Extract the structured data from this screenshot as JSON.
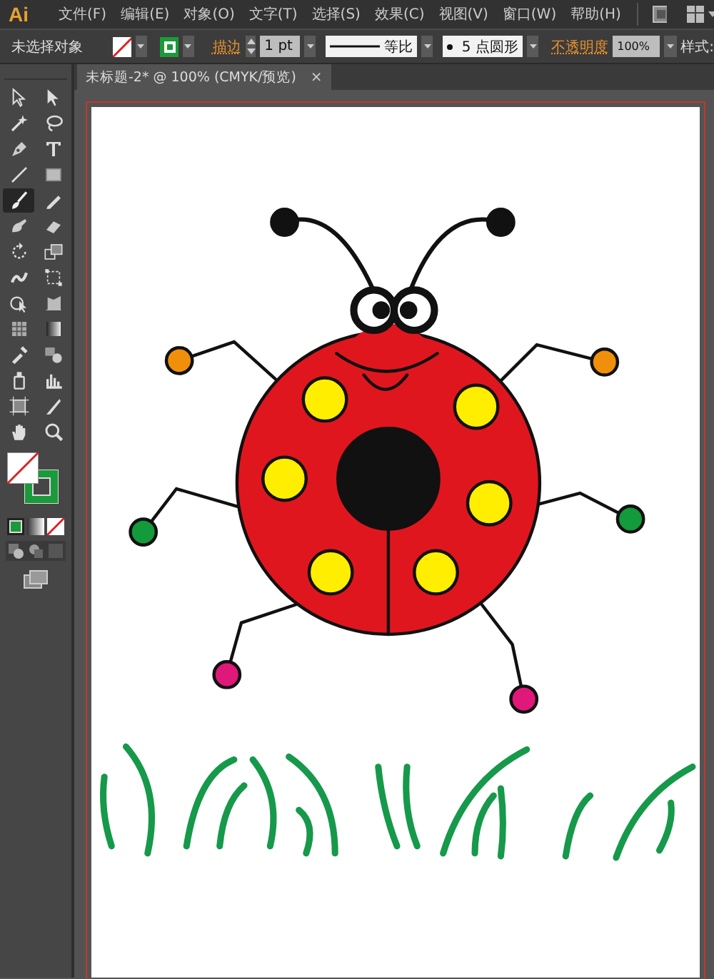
{
  "app": {
    "logo": "Ai"
  },
  "menu": [
    "文件(F)",
    "编辑(E)",
    "对象(O)",
    "文字(T)",
    "选择(S)",
    "效果(C)",
    "视图(V)",
    "窗口(W)",
    "帮助(H)"
  ],
  "control_bar": {
    "selection": "未选择对象",
    "stroke_label": "描边",
    "stroke_weight": "1 pt",
    "profile": "等比",
    "brush": "5 点圆形",
    "opacity_label": "不透明度",
    "opacity": "100%",
    "style_label": "样式:"
  },
  "document_tab": {
    "title": "未标题-2* @ 100% (CMYK/预览)",
    "close": "×"
  },
  "toolbar": {
    "tools": [
      {
        "selected": false
      },
      {
        "selected": false
      },
      {
        "selected": false
      },
      {
        "selected": false
      },
      {
        "selected": false
      },
      {
        "selected": false
      },
      {
        "selected": false
      },
      {
        "selected": false
      },
      {
        "selected": true
      },
      {
        "selected": false
      },
      {
        "selected": false
      },
      {
        "selected": false
      },
      {
        "selected": false
      },
      {
        "selected": false
      },
      {
        "selected": false
      },
      {
        "selected": false
      },
      {
        "selected": false
      },
      {
        "selected": false
      },
      {
        "selected": false
      },
      {
        "selected": false
      },
      {
        "selected": false
      },
      {
        "selected": false
      },
      {
        "selected": false
      },
      {
        "selected": false
      },
      {
        "selected": false
      },
      {
        "selected": false
      },
      {
        "selected": false
      },
      {
        "selected": false
      }
    ]
  }
}
